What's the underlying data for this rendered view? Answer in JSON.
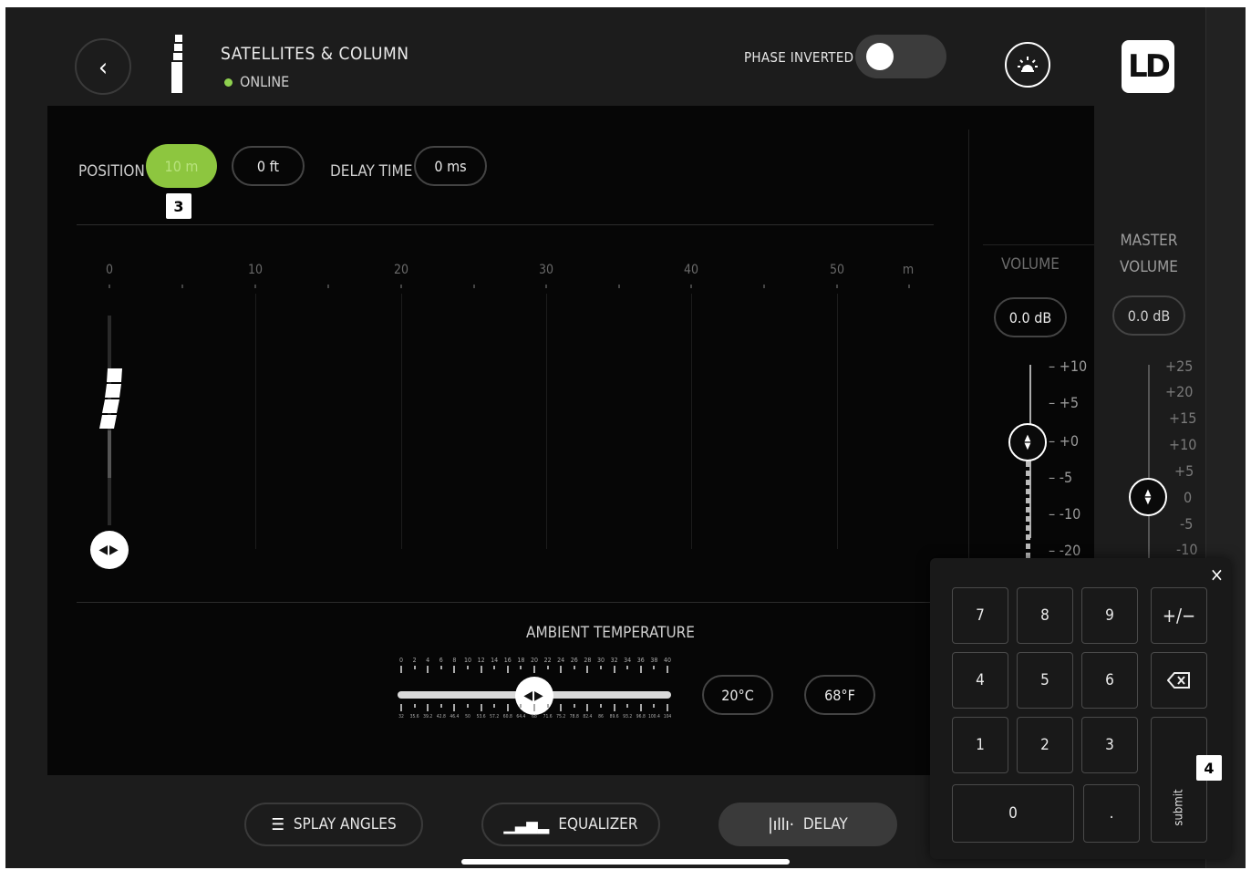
{
  "header": {
    "back_icon": "chevron-left-icon",
    "device_title": "SATELLITES & COLUMN",
    "status": "ONLINE",
    "status_color": "#8fd14f",
    "phase_label": "PHASE INVERTED",
    "phase_inverted": false,
    "identify_icon": "identify-light-icon",
    "logo_text": "LD"
  },
  "position": {
    "label": "POSITION",
    "value_m": "10 m",
    "value_ft": "0 ft",
    "accent": "#8dc63f",
    "badge": "3"
  },
  "delay_time": {
    "label": "DELAY TIME",
    "value": "0 ms"
  },
  "distance_scale": {
    "labels": [
      "0",
      "10",
      "20",
      "30",
      "40",
      "50"
    ],
    "unit": "m"
  },
  "ambient": {
    "label": "AMBIENT TEMPERATURE",
    "celsius_ticks": [
      "0",
      "2",
      "4",
      "6",
      "8",
      "10",
      "12",
      "14",
      "16",
      "18",
      "20",
      "22",
      "24",
      "26",
      "28",
      "30",
      "32",
      "34",
      "36",
      "38",
      "40"
    ],
    "fahrenheit_ticks": [
      "32",
      "35.6",
      "39.2",
      "42.8",
      "46.4",
      "50",
      "53.6",
      "57.2",
      "60.8",
      "64.4",
      "68",
      "71.6",
      "75.2",
      "78.8",
      "82.4",
      "86",
      "89.6",
      "93.2",
      "96.8",
      "100.4",
      "104"
    ],
    "celsius": "20°C",
    "fahrenheit": "68°F",
    "value_c": 20
  },
  "volume": {
    "label": "VOLUME",
    "value": "0.0 dB",
    "scale": [
      "+10",
      "+5",
      "+0",
      "-5",
      "-10",
      "-20"
    ]
  },
  "master_volume": {
    "label_line1": "MASTER",
    "label_line2": "VOLUME",
    "value": "0.0 dB",
    "scale": [
      "+25",
      "+20",
      "+15",
      "+10",
      "+5",
      "0",
      "-5",
      "-10"
    ]
  },
  "nav": {
    "splay": "SPLAY ANGLES",
    "equalizer": "EQUALIZER",
    "delay": "DELAY"
  },
  "keypad": {
    "close": "×",
    "keys": {
      "k7": "7",
      "k8": "8",
      "k9": "9",
      "plusminus": "+/−",
      "k4": "4",
      "k5": "5",
      "k6": "6",
      "backspace_icon": "backspace-icon",
      "k1": "1",
      "k2": "2",
      "k3": "3",
      "k0": "0",
      "dot": "."
    },
    "submit": "submit",
    "badge": "4"
  }
}
